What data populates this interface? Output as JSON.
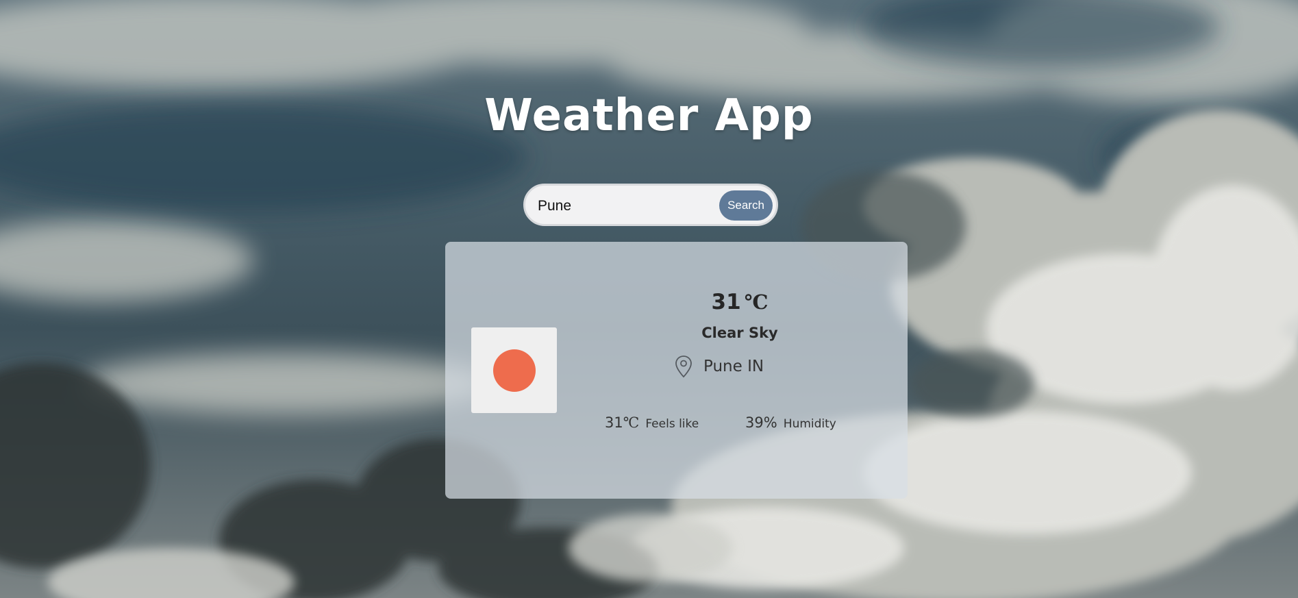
{
  "app": {
    "title": "Weather App"
  },
  "search": {
    "value": "Pune",
    "button_label": "Search"
  },
  "weather": {
    "temperature": "31",
    "temperature_unit": "℃",
    "condition": "Clear Sky",
    "location": "Pune IN",
    "condition_icon": "sun-icon",
    "location_icon": "location-pin-icon",
    "feels_like": {
      "value": "31",
      "unit": "℃",
      "label": "Feels like"
    },
    "humidity": {
      "value": "39%",
      "label": "Humidity"
    }
  },
  "colors": {
    "search_button": "#5f7a98",
    "sun": "#ee6c4d",
    "card_background": "#d7dee5"
  }
}
